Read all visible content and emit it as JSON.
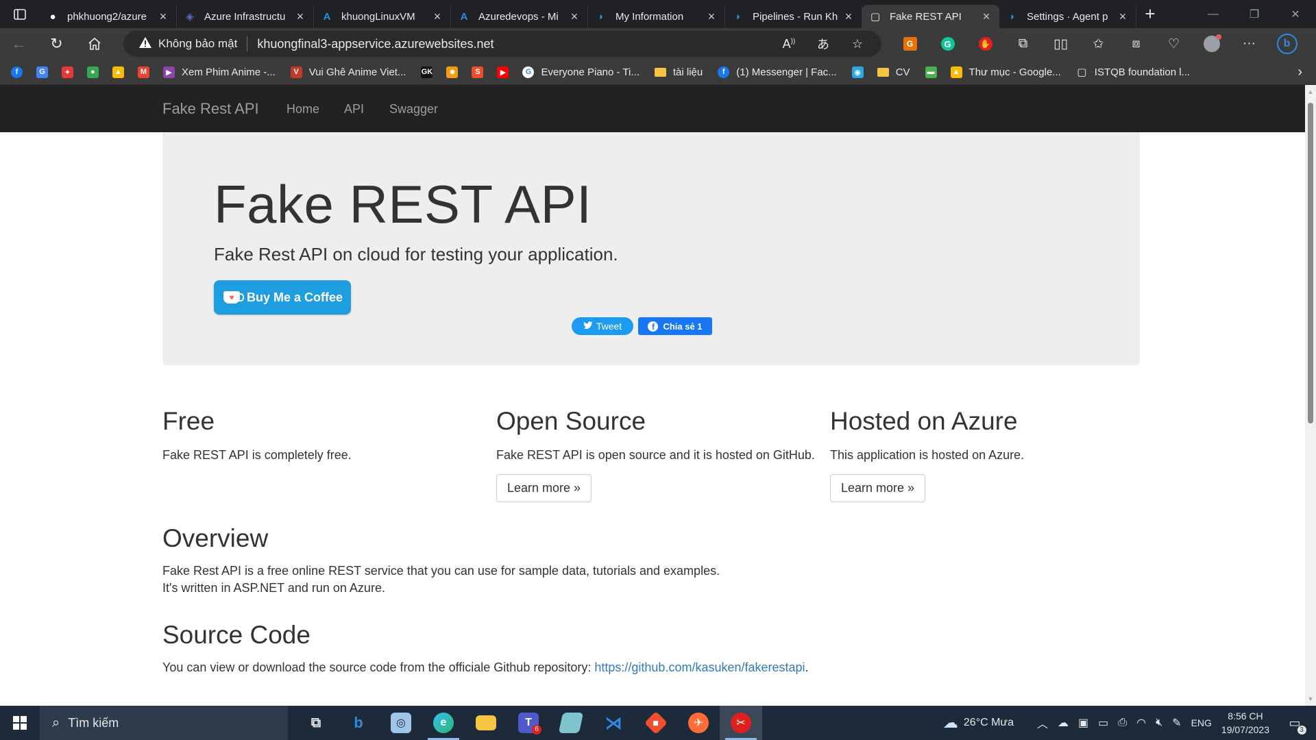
{
  "browser": {
    "tabs": [
      {
        "title": "phkhuong2/azure",
        "favicon": "github-icon",
        "color": "#ffffff"
      },
      {
        "title": "Azure Infrastructu",
        "favicon": "azure-infra-icon",
        "color": "#5c6bc0"
      },
      {
        "title": "khuongLinuxVM",
        "favicon": "azure-icon",
        "color": "#2f8ae5"
      },
      {
        "title": "Azuredevops - Mi",
        "favicon": "azure-icon",
        "color": "#2f8ae5"
      },
      {
        "title": "My Information",
        "favicon": "azure-devops-icon",
        "color": "#2f8ae5"
      },
      {
        "title": "Pipelines - Run Kh",
        "favicon": "azure-devops-icon",
        "color": "#2f8ae5"
      },
      {
        "title": "Fake REST API",
        "favicon": "page-icon",
        "color": "#e8eaed"
      },
      {
        "title": "Settings · Agent p",
        "favicon": "azure-devops-icon",
        "color": "#2f8ae5"
      }
    ],
    "new_tab": "+",
    "insecure_label": "Không bảo mật",
    "url": "khuongfinal3-appservice.azurewebsites.net",
    "bookmarks": [
      {
        "label": "",
        "icon": "facebook-icon",
        "color": "#1877f2",
        "glyph": "f"
      },
      {
        "label": "",
        "icon": "translate-icon",
        "color": "#4285f4",
        "glyph": "G"
      },
      {
        "label": "",
        "icon": "pinwheel-icon",
        "color": "#e53935",
        "glyph": "✦"
      },
      {
        "label": "",
        "icon": "maps-icon",
        "color": "#34a853",
        "glyph": "●"
      },
      {
        "label": "",
        "icon": "drive-icon",
        "color": "#fbbc04",
        "glyph": "▲"
      },
      {
        "label": "",
        "icon": "gmail-icon",
        "color": "#ea4335",
        "glyph": "M"
      },
      {
        "label": "Xem Phim Anime -...",
        "icon": "play-icon",
        "color": "#8e44ad",
        "glyph": "▶"
      },
      {
        "label": "Vui Ghê Anime Viet...",
        "icon": "anime-icon",
        "color": "#c0392b",
        "glyph": "V"
      },
      {
        "label": "",
        "icon": "gk-icon",
        "color": "#111111",
        "glyph": "GK"
      },
      {
        "label": "",
        "icon": "gear-icon",
        "color": "#f39c12",
        "glyph": "✹"
      },
      {
        "label": "",
        "icon": "shopee-icon",
        "color": "#ee4d2d",
        "glyph": "S"
      },
      {
        "label": "",
        "icon": "youtube-icon",
        "color": "#ff0000",
        "glyph": "▶"
      },
      {
        "label": "Everyone Piano - Ti...",
        "icon": "google-icon",
        "color": "#ffffff",
        "glyph": "G"
      },
      {
        "label": "tài liệu",
        "icon": "folder-icon",
        "color": "#f5c542",
        "glyph": ""
      },
      {
        "label": "(1) Messenger | Fac...",
        "icon": "facebook-icon",
        "color": "#1877f2",
        "glyph": "f"
      },
      {
        "label": "",
        "icon": "camera-icon",
        "color": "#2aa7e0",
        "glyph": "◉"
      },
      {
        "label": "CV",
        "icon": "folder-icon",
        "color": "#f5c542",
        "glyph": ""
      },
      {
        "label": "",
        "icon": "frog-icon",
        "color": "#4caf50",
        "glyph": "▬"
      },
      {
        "label": "Thư mục - Google...",
        "icon": "drive-icon",
        "color": "#fbbc04",
        "glyph": "▲"
      },
      {
        "label": "ISTQB foundation l...",
        "icon": "page-icon",
        "color": "transparent",
        "glyph": "▢"
      }
    ]
  },
  "site": {
    "brand": "Fake Rest API",
    "nav": [
      "Home",
      "API",
      "Swagger"
    ],
    "hero_title": "Fake REST API",
    "hero_lead": "Fake Rest API on cloud for testing your application.",
    "coffee_label": "Buy Me a Coffee",
    "tweet_label": "Tweet",
    "share_label": "Chia sẻ 1",
    "features": [
      {
        "title": "Free",
        "text": "Fake REST API is completely free.",
        "button": ""
      },
      {
        "title": "Open Source",
        "text": "Fake REST API is open source and it is hosted on GitHub.",
        "button": "Learn more »"
      },
      {
        "title": "Hosted on Azure",
        "text": "This application is hosted on Azure.",
        "button": "Learn more »"
      }
    ],
    "overview_title": "Overview",
    "overview_line1": "Fake Rest API is a free online REST service that you can use for sample data, tutorials and examples.",
    "overview_line2": "It's written in ASP.NET and run on Azure.",
    "source_title": "Source Code",
    "source_text": "You can view or download the source code from the officiale Github repository: ",
    "source_link": "https://github.com/kasuken/fakerestapi",
    "source_end": "."
  },
  "taskbar": {
    "search_placeholder": "Tìm kiếm",
    "weather": "26°C  Mưa",
    "language": "ENG",
    "time": "8:56 CH",
    "date": "19/07/2023",
    "notifications": "3",
    "teams_badge": "6"
  }
}
